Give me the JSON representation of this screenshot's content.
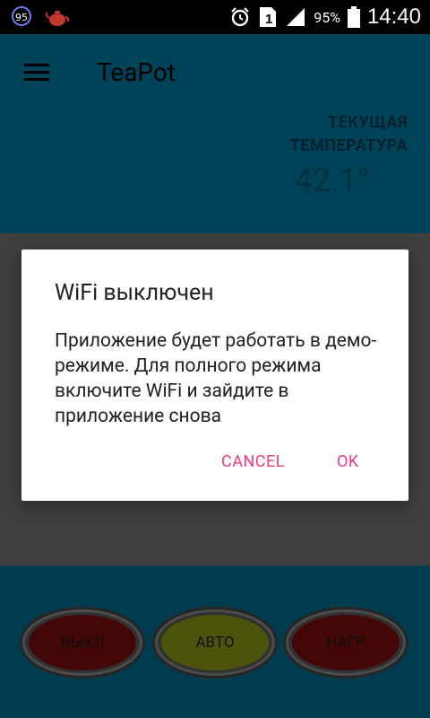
{
  "status_bar": {
    "notification_badge": "95",
    "battery": "95%",
    "time": "14:40",
    "sim_indicator": "1",
    "icons": [
      "notification-count-icon",
      "teapot-icon",
      "alarm-icon",
      "sim-icon",
      "signal-icon",
      "battery-icon"
    ]
  },
  "app_bar": {
    "title": "TeaPot",
    "menu_icon": "hamburger-menu-icon"
  },
  "temperature": {
    "label": "ТЕКУЩАЯ ТЕМПЕРАТУРА",
    "value": "42.1°"
  },
  "controls": {
    "off_label": "ВЫКЛ",
    "auto_label": "АВТО",
    "heat_label": "НАГР",
    "colors": {
      "off": "#7a0e0e",
      "auto": "#8a9a17",
      "heat": "#7a0e0e"
    }
  },
  "dialog": {
    "title": "WiFi выключен",
    "message": "Приложение будет работать в демо-режиме. Для полного режима включите WiFi и зайдите в приложение снова",
    "cancel_label": "CANCEL",
    "ok_label": "OK",
    "accent_color": "#ef3c80"
  },
  "colors": {
    "primary": "#00799f",
    "scrim": "#000000"
  }
}
